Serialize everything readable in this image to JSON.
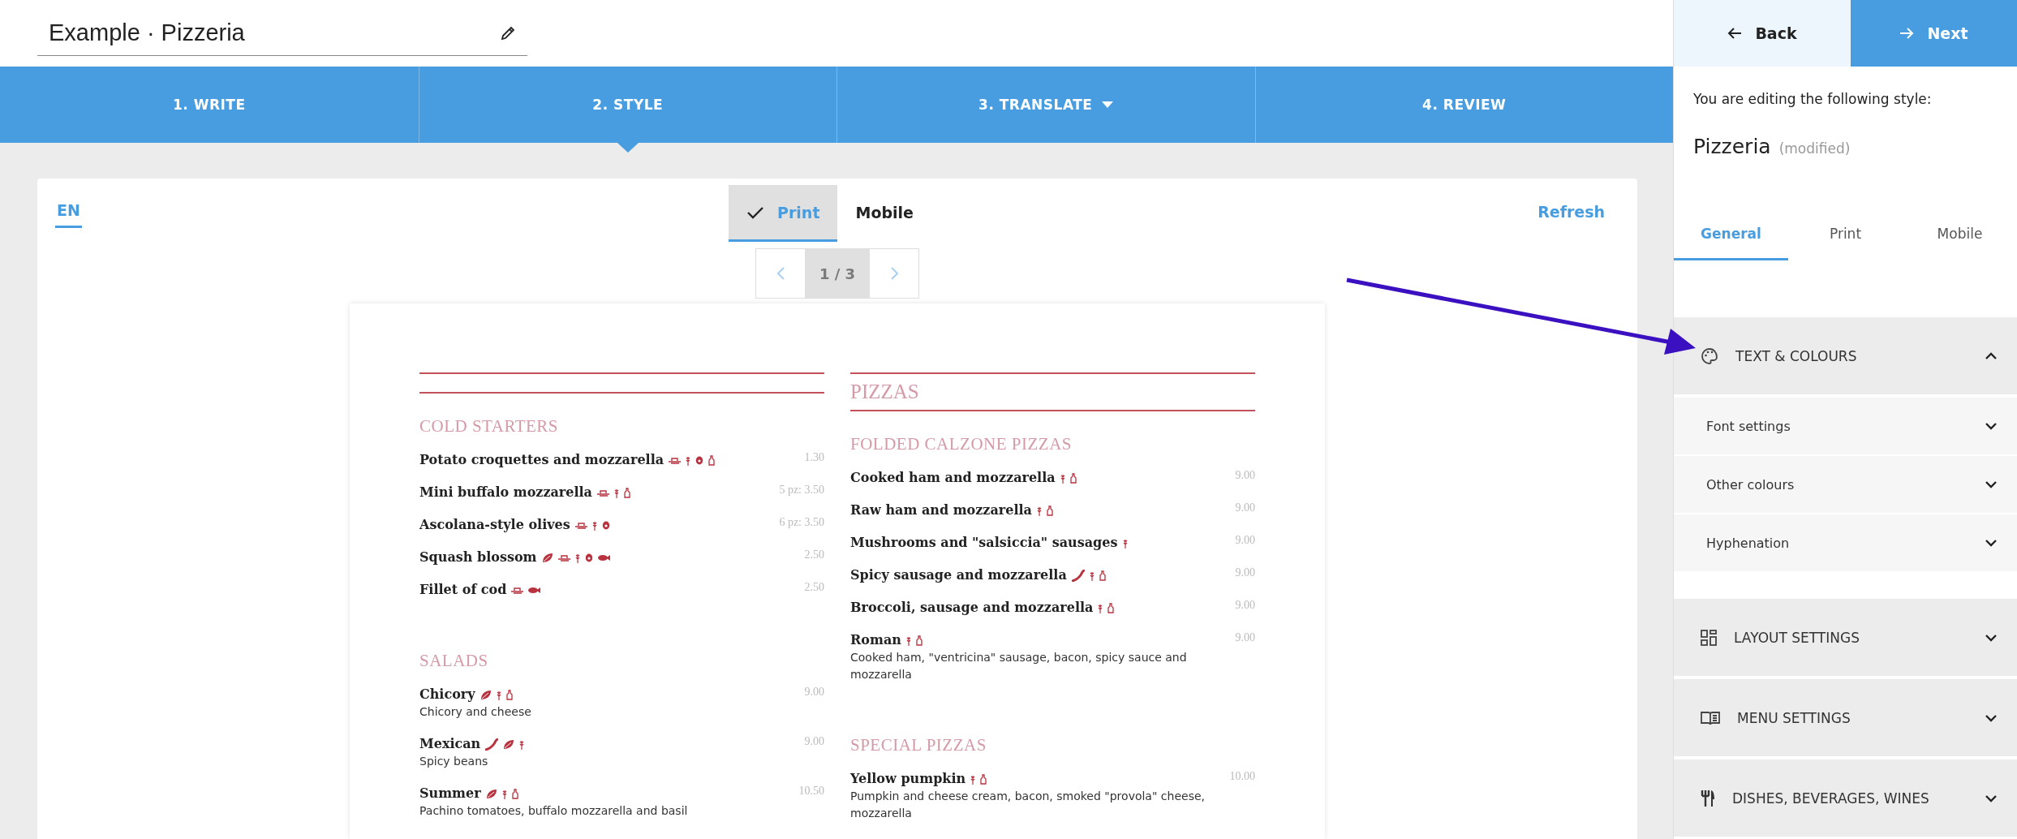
{
  "project_title": "Example · Pizzeria",
  "steps": [
    {
      "label": "1. WRITE",
      "selected": false,
      "dropdown": false
    },
    {
      "label": "2. STYLE",
      "selected": true,
      "dropdown": false
    },
    {
      "label": "3. TRANSLATE",
      "selected": false,
      "dropdown": true
    },
    {
      "label": "4. REVIEW",
      "selected": false,
      "dropdown": false
    }
  ],
  "preview": {
    "languages": [
      {
        "label": "EN",
        "selected": true
      }
    ],
    "formats": [
      {
        "label": "Print",
        "selected": true
      },
      {
        "label": "Mobile",
        "selected": false
      }
    ],
    "refresh": "Refresh",
    "page": "1 / 3",
    "columns": [
      {
        "groups": [
          {
            "heading": "COLD STARTERS",
            "dishes": [
              {
                "name": "Potato croquettes and mozzarella",
                "allergens": [
                  {
                    "kind": "dish"
                  },
                  {
                    "kind": "grain"
                  },
                  {
                    "kind": "egg"
                  },
                  {
                    "kind": "bottle"
                  }
                ],
                "price": "1.30"
              },
              {
                "name": "Mini buffalo mozzarella",
                "allergens": [
                  {
                    "kind": "dish"
                  },
                  {
                    "kind": "grain"
                  },
                  {
                    "kind": "bottle"
                  }
                ],
                "price": "5 pz: 3.50"
              },
              {
                "name": "Ascolana-style olives",
                "allergens": [
                  {
                    "kind": "dish"
                  },
                  {
                    "kind": "grain"
                  },
                  {
                    "kind": "egg"
                  }
                ],
                "price": "6 pz: 3.50"
              },
              {
                "name": "Squash blossom",
                "allergens": [
                  {
                    "kind": "leaf"
                  },
                  {
                    "kind": "dish"
                  },
                  {
                    "kind": "grain"
                  },
                  {
                    "kind": "egg"
                  },
                  {
                    "kind": "fish"
                  }
                ],
                "price": "2.50"
              },
              {
                "name": "Fillet of cod",
                "allergens": [
                  {
                    "kind": "dish"
                  },
                  {
                    "kind": "fish"
                  }
                ],
                "price": "2.50"
              }
            ]
          },
          {
            "heading": "SALADS",
            "dishes": [
              {
                "name": "Chicory",
                "allergens": [
                  {
                    "kind": "leaf"
                  },
                  {
                    "kind": "grain"
                  },
                  {
                    "kind": "bottle"
                  }
                ],
                "price": "9.00",
                "description": "Chicory and cheese"
              },
              {
                "name": "Mexican",
                "allergens": [
                  {
                    "kind": "chili"
                  },
                  {
                    "kind": "leaf"
                  },
                  {
                    "kind": "grain"
                  }
                ],
                "price": "9.00",
                "description": "Spicy beans"
              },
              {
                "name": "Summer",
                "allergens": [
                  {
                    "kind": "leaf"
                  },
                  {
                    "kind": "grain"
                  },
                  {
                    "kind": "bottle"
                  }
                ],
                "price": "10.50",
                "description": "Pachino tomatoes, buffalo mozzarella and basil"
              }
            ]
          }
        ]
      },
      {
        "title": "PIZZAS",
        "groups": [
          {
            "heading": "FOLDED CALZONE PIZZAS",
            "dishes": [
              {
                "name": "Cooked ham and mozzarella",
                "allergens": [
                  {
                    "kind": "grain"
                  },
                  {
                    "kind": "bottle"
                  }
                ],
                "price": "9.00"
              },
              {
                "name": "Raw ham and mozzarella",
                "allergens": [
                  {
                    "kind": "grain"
                  },
                  {
                    "kind": "bottle"
                  }
                ],
                "price": "9.00"
              },
              {
                "name": "Mushrooms and \"salsiccia\" sausages",
                "allergens": [
                  {
                    "kind": "grain"
                  }
                ],
                "price": "9.00"
              },
              {
                "name": "Spicy sausage and mozzarella",
                "allergens": [
                  {
                    "kind": "chili"
                  },
                  {
                    "kind": "grain"
                  },
                  {
                    "kind": "bottle"
                  }
                ],
                "price": "9.00"
              },
              {
                "name": "Broccoli, sausage and mozzarella",
                "allergens": [
                  {
                    "kind": "grain"
                  },
                  {
                    "kind": "bottle"
                  }
                ],
                "price": "9.00"
              },
              {
                "name": "Roman",
                "allergens": [
                  {
                    "kind": "grain"
                  },
                  {
                    "kind": "bottle"
                  }
                ],
                "price": "9.00",
                "description": "Cooked ham, \"ventricina\" sausage, bacon, spicy sauce and mozzarella"
              }
            ]
          },
          {
            "heading": "SPECIAL PIZZAS",
            "dishes": [
              {
                "name": "Yellow pumpkin",
                "allergens": [
                  {
                    "kind": "grain"
                  },
                  {
                    "kind": "bottle"
                  }
                ],
                "price": "10.00",
                "description": "Pumpkin and cheese cream, bacon, smoked \"provola\" cheese, mozzarella"
              }
            ]
          }
        ]
      }
    ]
  },
  "sidebar": {
    "back": "Back",
    "next": "Next",
    "intro": "You are editing the following style:",
    "style_name": "Pizzeria",
    "style_note": "(modified)",
    "tabs": [
      {
        "label": "General",
        "selected": true
      },
      {
        "label": "Print",
        "selected": false
      },
      {
        "label": "Mobile",
        "selected": false
      }
    ],
    "sections": [
      {
        "title": "TEXT & COLOURS",
        "kind": "palette",
        "expanded": true,
        "children": [
          {
            "label": "Font settings",
            "expanded": false
          },
          {
            "label": "Other colours",
            "expanded": false
          },
          {
            "label": "Hyphenation",
            "expanded": false
          }
        ]
      },
      {
        "title": "LAYOUT SETTINGS",
        "kind": "layout",
        "expanded": false
      },
      {
        "title": "MENU SETTINGS",
        "kind": "book",
        "expanded": false
      },
      {
        "title": "DISHES, BEVERAGES, WINES",
        "kind": "cutlery",
        "expanded": false
      }
    ]
  }
}
